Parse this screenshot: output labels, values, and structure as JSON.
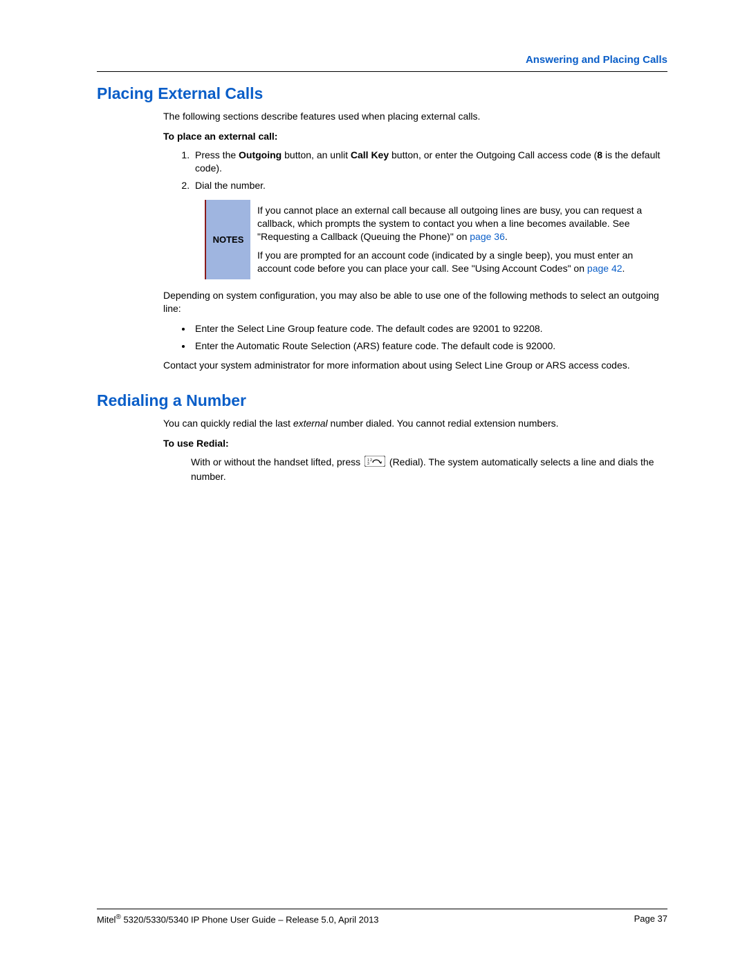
{
  "header": {
    "chapter": "Answering and Placing Calls"
  },
  "s1": {
    "title": "Placing External Calls",
    "intro": "The following sections describe features used when placing external calls.",
    "subhead": "To place an external call:",
    "step1_a": "Press the ",
    "step1_b": "Outgoing",
    "step1_c": " button, an unlit ",
    "step1_d": "Call Key",
    "step1_e": " button, or enter the Outgoing Call access code (",
    "step1_f": "8",
    "step1_g": " is the default code).",
    "step2": "Dial the number.",
    "notes_label": "NOTES",
    "note1_a": "If you cannot place an external call because all outgoing lines are busy, you can request a callback, which prompts the system to contact you when a line becomes available. See \"Requesting a Callback (Queuing the Phone)\" on ",
    "note1_link": "page 36",
    "note1_b": ".",
    "note2_a": "If you are prompted for an account code (indicated by a single beep), you must enter an account code before you can place your call. See \"Using Account Codes\" on ",
    "note2_link": "page 42",
    "note2_b": ".",
    "depending": "Depending on system configuration, you may also be able to use one of the following methods to select an outgoing line:",
    "bullet1": "Enter the Select Line Group feature code. The default codes are 92001 to 92208.",
    "bullet2": "Enter the Automatic Route Selection (ARS) feature code. The default code is 92000.",
    "contact": "Contact your system administrator for more information about using Select Line Group or ARS access codes."
  },
  "s2": {
    "title": "Redialing a Number",
    "intro_a": "You can quickly redial the last ",
    "intro_b": "external",
    "intro_c": " number dialed. You cannot redial extension numbers.",
    "subhead": "To use Redial:",
    "body_a": "With or without the handset lifted, press ",
    "body_b": " (Redial). The system automatically selects a line and dials the number."
  },
  "footer": {
    "left_a": "Mitel",
    "left_sup": "®",
    "left_b": " 5320/5330/5340 IP Phone User Guide – Release 5.0, April 2013",
    "right": "Page 37"
  }
}
